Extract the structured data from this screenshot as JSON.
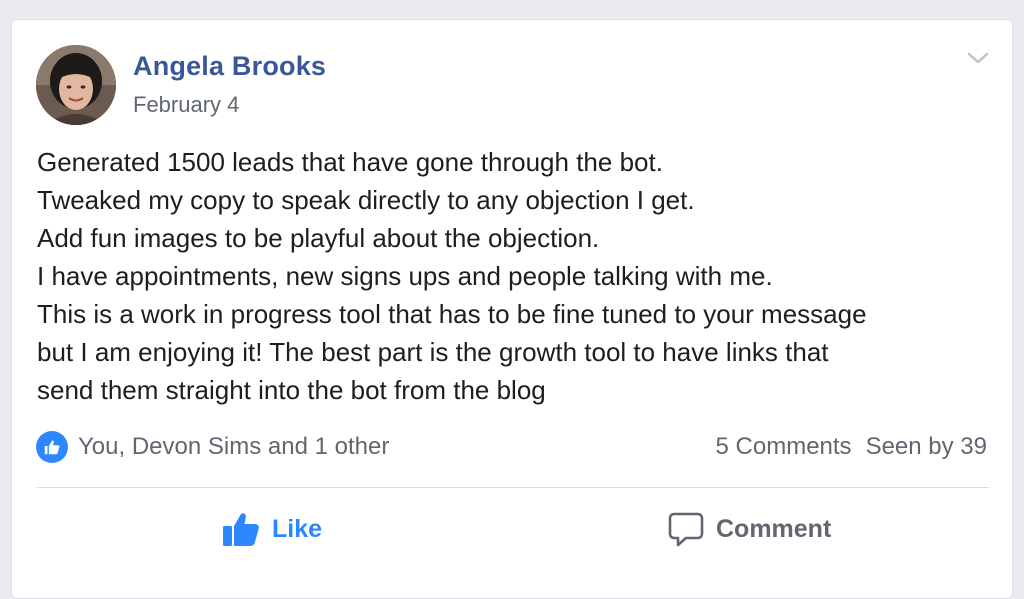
{
  "post": {
    "author": "Angela Brooks",
    "date": "February 4",
    "avatar_icon": "profile-photo",
    "menu_icon": "chevron-down-icon",
    "lines": [
      "Generated 1500 leads that have gone through the bot.",
      "Tweaked my copy to speak directly to any objection I get.",
      "Add fun images to be playful about the objection.",
      "I have appointments, new signs ups and people talking with me.",
      "This is a work in progress tool that has to be fine tuned to your message",
      "but I am enjoying it! The best part is the growth tool to have links that",
      "send them straight into the bot from the blog"
    ]
  },
  "footer": {
    "reactions_text": "You, Devon Sims and 1 other",
    "comments_count": "5 Comments",
    "seen_by": "Seen by 39"
  },
  "actions": {
    "like_label": "Like",
    "comment_label": "Comment"
  },
  "colors": {
    "author_link": "#385898",
    "like_blue": "#2d88ff",
    "secondary_text": "#606770",
    "body_text": "#1c1e21",
    "background": "#e9ebee"
  }
}
